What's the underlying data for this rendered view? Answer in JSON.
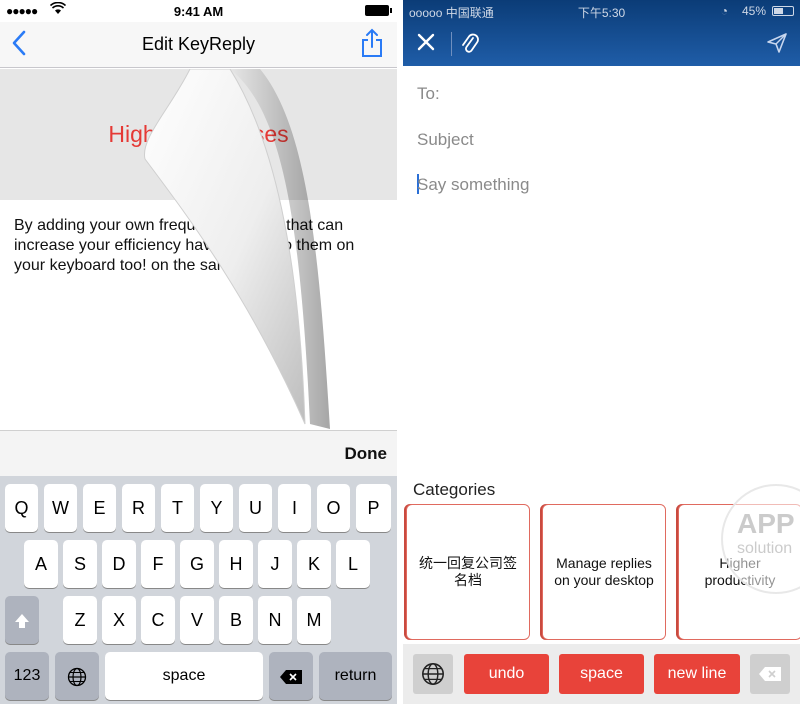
{
  "left": {
    "status": {
      "time": "9:41 AM"
    },
    "nav": {
      "title": "Edit KeyReply"
    },
    "banner_text": "Higher responses",
    "body_text": "By adding your own frequently means that can increase your efficiency have access to them on your keyboard too! on the same",
    "toolbar": {
      "done_label": "Done"
    },
    "keyboard": {
      "row1": [
        "Q",
        "W",
        "E",
        "R",
        "T",
        "Y",
        "U",
        "I",
        "O",
        "P"
      ],
      "row2": [
        "A",
        "S",
        "D",
        "F",
        "G",
        "H",
        "J",
        "K",
        "L"
      ],
      "row3": [
        "Z",
        "X",
        "C",
        "V",
        "B",
        "N",
        "M"
      ],
      "numbers_label": "123",
      "space_label": "space",
      "return_label": "return"
    }
  },
  "right": {
    "status": {
      "carrier": "ooooo 中国联通",
      "time": "下午5:30",
      "battery": "45%"
    },
    "compose": {
      "to_label": "To:",
      "subject_placeholder": "Subject",
      "body_placeholder": "Say something"
    },
    "categories_title": "Categories",
    "categories": [
      {
        "label": "统一回复公司签名档"
      },
      {
        "label": "Manage replies on your desktop"
      },
      {
        "label": "Higher productivity"
      }
    ],
    "bar": {
      "undo_label": "undo",
      "space_label": "space",
      "newline_label": "new line"
    },
    "watermark": {
      "line1": "APP",
      "line2": "solution"
    },
    "accent_color": "#e8433a",
    "header_color": "#1f5da8"
  }
}
